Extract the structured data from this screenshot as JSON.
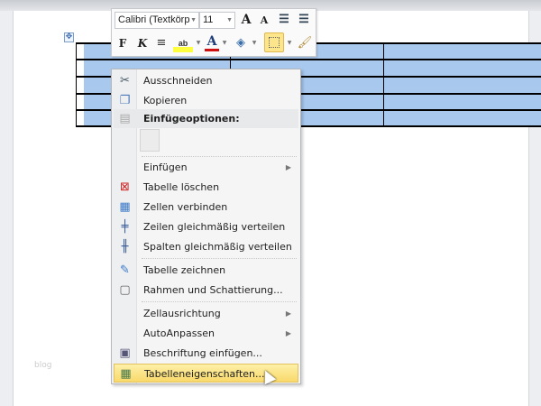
{
  "mini_toolbar": {
    "font": "Calibri (Textkörp",
    "size": "11",
    "bold": "F",
    "italic": "K",
    "grow": "A",
    "shrink": "A",
    "font_color": "A",
    "highlight": "ab"
  },
  "watermark": "blog",
  "menu": {
    "items": [
      {
        "label": "Ausschneiden",
        "icon": "scissors-icon"
      },
      {
        "label": "Kopieren",
        "icon": "copy-icon"
      },
      {
        "label": "Einfügeoptionen:",
        "icon": "paste-icon",
        "header": true
      },
      {
        "label": "Einfügen",
        "submenu": true
      },
      {
        "label": "Tabelle löschen",
        "icon": "delete-table-icon"
      },
      {
        "label": "Zellen verbinden",
        "icon": "merge-cells-icon"
      },
      {
        "label": "Zeilen gleichmäßig verteilen",
        "icon": "distribute-rows-icon"
      },
      {
        "label": "Spalten gleichmäßig verteilen",
        "icon": "distribute-columns-icon"
      },
      {
        "label": "Tabelle zeichnen",
        "icon": "draw-table-icon"
      },
      {
        "label": "Rahmen und Schattierung...",
        "icon": "borders-icon"
      },
      {
        "label": "Zellausrichtung",
        "submenu": true
      },
      {
        "label": "AutoAnpassen",
        "submenu": true
      },
      {
        "label": "Beschriftung einfügen...",
        "icon": "caption-icon"
      },
      {
        "label": "Tabelleneigenschaften...",
        "icon": "table-properties-icon",
        "highlighted": true
      }
    ]
  }
}
